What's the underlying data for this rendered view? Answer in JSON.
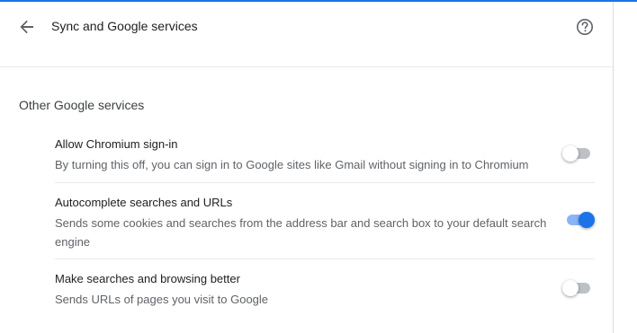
{
  "header": {
    "title": "Sync and Google services"
  },
  "section": {
    "title": "Other Google services"
  },
  "settings": [
    {
      "title": "Allow Chromium sign-in",
      "description": "By turning this off, you can sign in to Google sites like Gmail without signing in to Chromium",
      "enabled": false
    },
    {
      "title": "Autocomplete searches and URLs",
      "description": "Sends some cookies and searches from the address bar and search box to your default search engine",
      "enabled": true
    },
    {
      "title": "Make searches and browsing better",
      "description": "Sends URLs of pages you visit to Google",
      "enabled": false
    }
  ],
  "colors": {
    "accent": "#1a73e8",
    "toggle_track_on": "#8ab4f8",
    "toggle_track_off": "#bdc1c6"
  }
}
